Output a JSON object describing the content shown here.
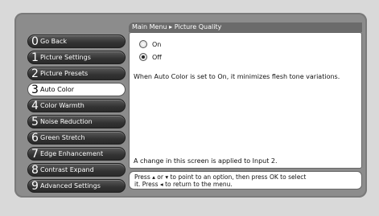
{
  "breadcrumb": "Main Menu ▸ Picture Quality",
  "menu": [
    {
      "num": "0",
      "label": "Go Back"
    },
    {
      "num": "1",
      "label": "Picture Settings"
    },
    {
      "num": "2",
      "label": "Picture Presets"
    },
    {
      "num": "3",
      "label": "Auto Color"
    },
    {
      "num": "4",
      "label": "Color Warmth"
    },
    {
      "num": "5",
      "label": "Noise Reduction"
    },
    {
      "num": "6",
      "label": "Green Stretch"
    },
    {
      "num": "7",
      "label": "Edge Enhancement"
    },
    {
      "num": "8",
      "label": "Contrast Expand"
    },
    {
      "num": "9",
      "label": "Advanced Settings"
    }
  ],
  "options": [
    {
      "label": "On",
      "selected": false
    },
    {
      "label": "Off",
      "selected": true
    }
  ],
  "description": "When Auto Color is set to On, it minimizes flesh tone variations.",
  "apply_note": "A change in this screen is applied to Input 2.",
  "footer_line1": "Press ▴ or ▾ to point to an option, then press OK to select",
  "footer_line2": "it. Press ◂ to return to the menu."
}
